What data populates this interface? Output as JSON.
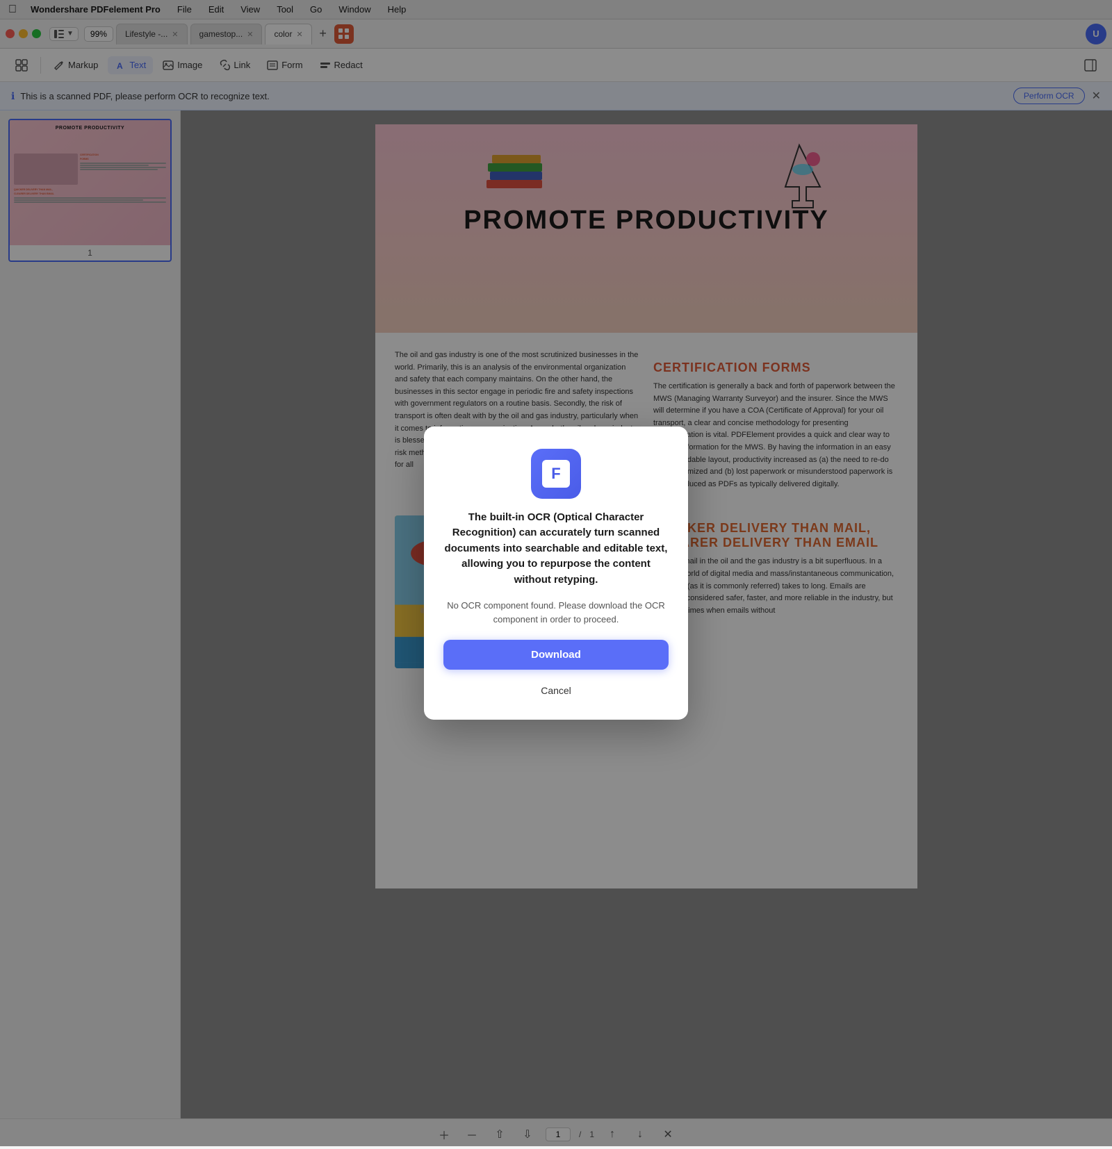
{
  "menubar": {
    "apple": "⌘",
    "app_name": "Wondershare PDFelement Pro",
    "menus": [
      "File",
      "Edit",
      "View",
      "Tool",
      "Go",
      "Window",
      "Help"
    ]
  },
  "tabbar": {
    "zoom": "99%",
    "tabs": [
      {
        "label": "Lifestyle -...",
        "active": false
      },
      {
        "label": "gamestop...",
        "active": false
      },
      {
        "label": "color",
        "active": true
      }
    ],
    "add_label": "+",
    "avatar_label": "U"
  },
  "toolbar": {
    "buttons": [
      {
        "label": "Markup",
        "icon": "markup-icon"
      },
      {
        "label": "Text",
        "icon": "text-icon"
      },
      {
        "label": "Image",
        "icon": "image-icon"
      },
      {
        "label": "Link",
        "icon": "link-icon"
      },
      {
        "label": "Form",
        "icon": "form-icon"
      },
      {
        "label": "Redact",
        "icon": "redact-icon"
      }
    ]
  },
  "ocr_banner": {
    "message": "This is a scanned PDF, please perform OCR to recognize text.",
    "button_label": "Perform OCR",
    "info_icon": "ℹ"
  },
  "sidebar": {
    "page_number": "1"
  },
  "document": {
    "heading": "PROMOTE PRODUCTIVITY",
    "certification_heading": "CERTIFICATION FORMS",
    "body_text_1": "The oil and gas industry is one of the most scrutinized businesses in the world. Primarily, this is an analysis of the environmental organization and safety that each company maintains. On the other hand, the businesses in this sector engage in periodic fire and safety inspections with government regulators on a routine basis. Secondly, the risk of transport is often dealt with by the oil and gas industry, particularly when it comes to information communication. As such, the oil and gas industry is blessed with a highly regulated environment. Having a high-caliber risk methodology and a corporate methodology set by risk professionals for all",
    "body_text_2": "The certification is generally a back and forth of paperwork between the MWS (Managing Warranty Surveyor) and the insurer. Since the MWS will determine if you have a COA (Certificate of Approval) for your oil transport, a clear and concise methodology for presenting documentation is vital. PDFElement provides a quick and clear way to present information for the MWS. By having the information in an easy understandable layout, productivity increased as (a) the need to re-do tasks minimized and (b) lost paperwork or misunderstood paperwork is greatly reduced as PDFs as typically delivered digitally.",
    "quicker_heading": "QUICKER DELIVERY THAN MAIL, CLEARER DELIVERY THAN EMAIL",
    "quicker_text": "Sending mail in the oil and the gas industry is a bit superfluous. In a modern world of digital media and mass/instantaneous communication, snail mail (as it is commonly referred) takes to long. Emails are generally considered safer, faster, and more reliable in the industry, but there are times when emails without"
  },
  "modal": {
    "icon_letter": "F",
    "title": "The built-in OCR (Optical Character Recognition) can accurately turn scanned documents into searchable and editable text, allowing you to repurpose the content without retyping.",
    "description": "No OCR component found. Please download the OCR component in order to proceed.",
    "download_label": "Download",
    "cancel_label": "Cancel"
  },
  "bottom_bar": {
    "page_current": "1",
    "page_total": "1"
  }
}
